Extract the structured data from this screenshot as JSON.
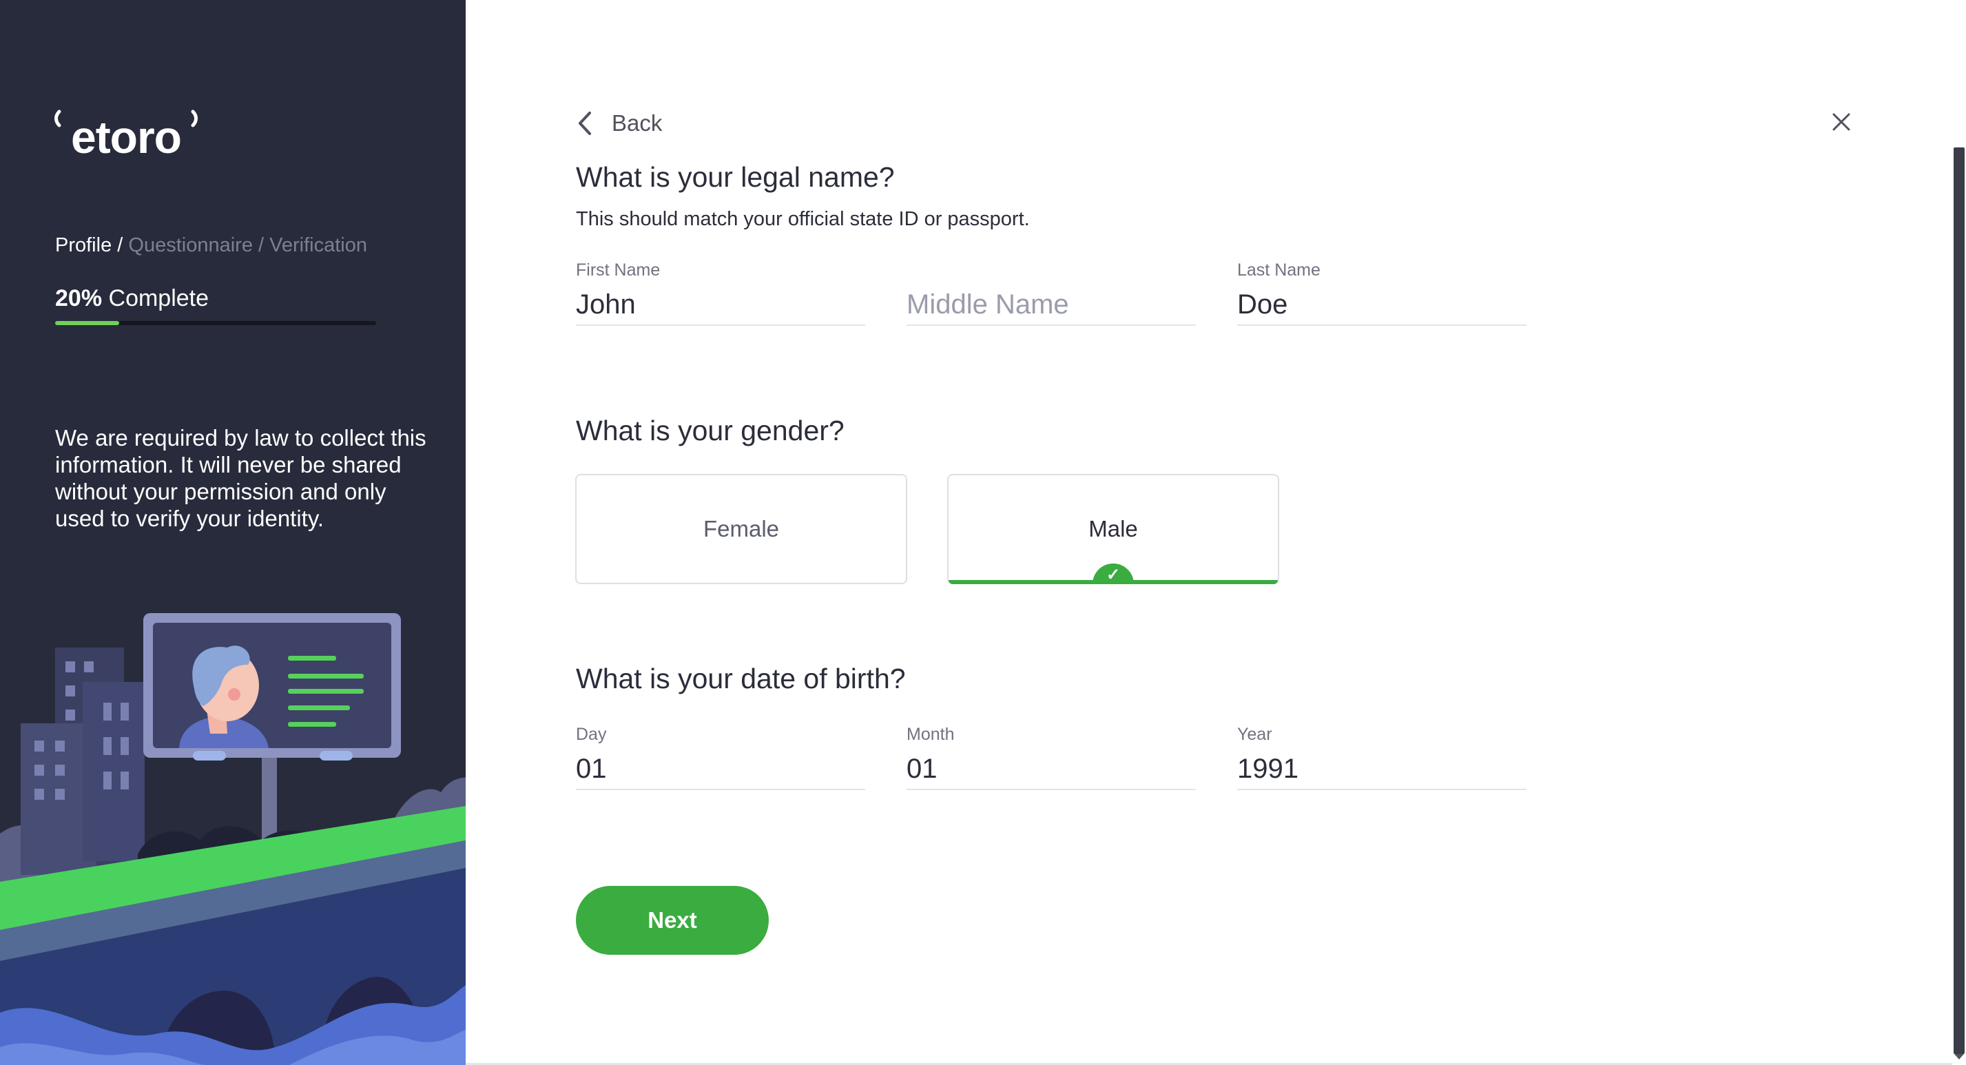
{
  "brand": {
    "logo_text": "etoro",
    "accent": "#3aac40",
    "panel_bg": "#282b3b"
  },
  "sidebar": {
    "steps": {
      "current": "Profile /",
      "rest": " Questionnaire / Verification"
    },
    "progress": {
      "percent_text": "20%",
      "suffix": " Complete",
      "value": 0.2
    },
    "notice": "We are required by law to collect this information. It will never be shared without your permission and only used to verify your identity."
  },
  "nav": {
    "back_label": "Back",
    "close_icon": "close-icon"
  },
  "legal_name": {
    "title": "What is your legal name?",
    "subtitle": "This should match your official state ID or passport.",
    "first": {
      "label": "First Name",
      "value": "John",
      "placeholder": "First Name"
    },
    "middle": {
      "label": "",
      "value": "",
      "placeholder": "Middle Name"
    },
    "last": {
      "label": "Last Name",
      "value": "Doe",
      "placeholder": "Last Name"
    }
  },
  "gender": {
    "title": "What is your gender?",
    "options": [
      {
        "label": "Female",
        "selected": false
      },
      {
        "label": "Male",
        "selected": true
      }
    ],
    "check_glyph": "✓"
  },
  "dob": {
    "title": "What is your date of birth?",
    "day": {
      "label": "Day",
      "value": "01"
    },
    "month": {
      "label": "Month",
      "value": "01"
    },
    "year": {
      "label": "Year",
      "value": "1991"
    }
  },
  "actions": {
    "next_label": "Next"
  }
}
